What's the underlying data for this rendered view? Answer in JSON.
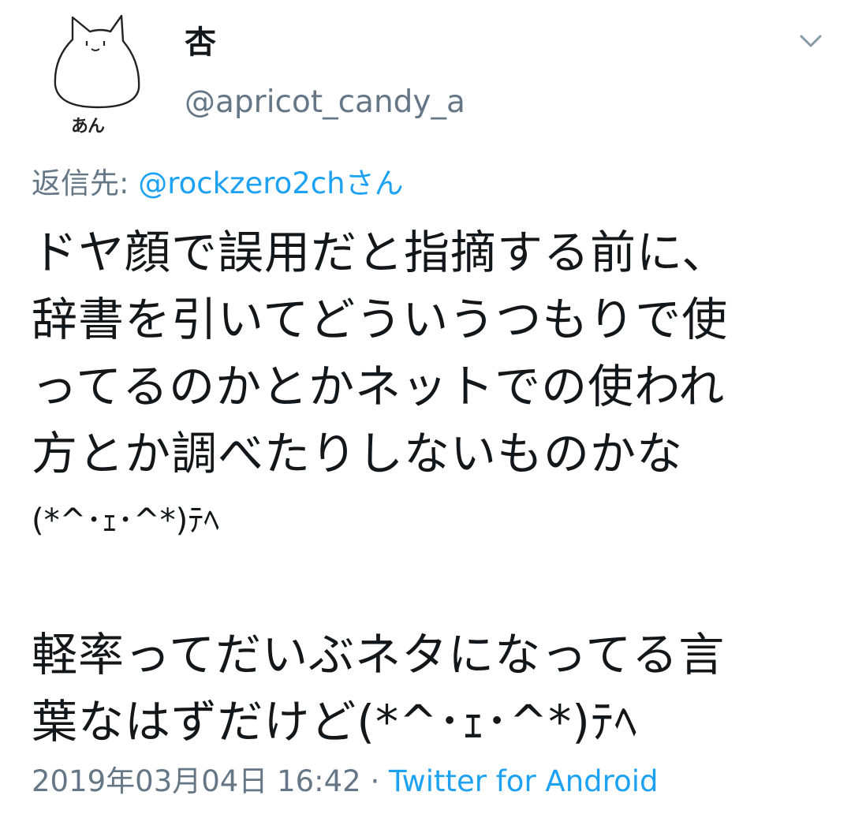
{
  "user": {
    "display_name": "杏",
    "handle": "@apricot_candy_a",
    "avatar_caption": "あん"
  },
  "reply": {
    "prefix": "返信先: ",
    "mention": "@rockzero2chさん"
  },
  "tweet": {
    "lines": [
      "ドヤ顔で誤用だと指摘する前に、",
      "辞書を引いてどういうつもりで使",
      "ってるのかとかネットでの使われ",
      "方とか調べたりしないものかな",
      "(*^･ｪ･^*)ﾃﾍ",
      "",
      "軽率ってだいぶネタになってる言",
      "葉なはずだけど(*^･ｪ･^*)ﾃﾍ"
    ]
  },
  "meta": {
    "timestamp": "2019年03月04日 16:42",
    "separator": " · ",
    "source": "Twitter for Android"
  },
  "icons": {
    "menu": "chevron-down-icon",
    "avatar": "cat-avatar-icon"
  },
  "colors": {
    "link": "#1da1f2",
    "secondary_text": "#657786",
    "primary_text": "#14171a"
  }
}
